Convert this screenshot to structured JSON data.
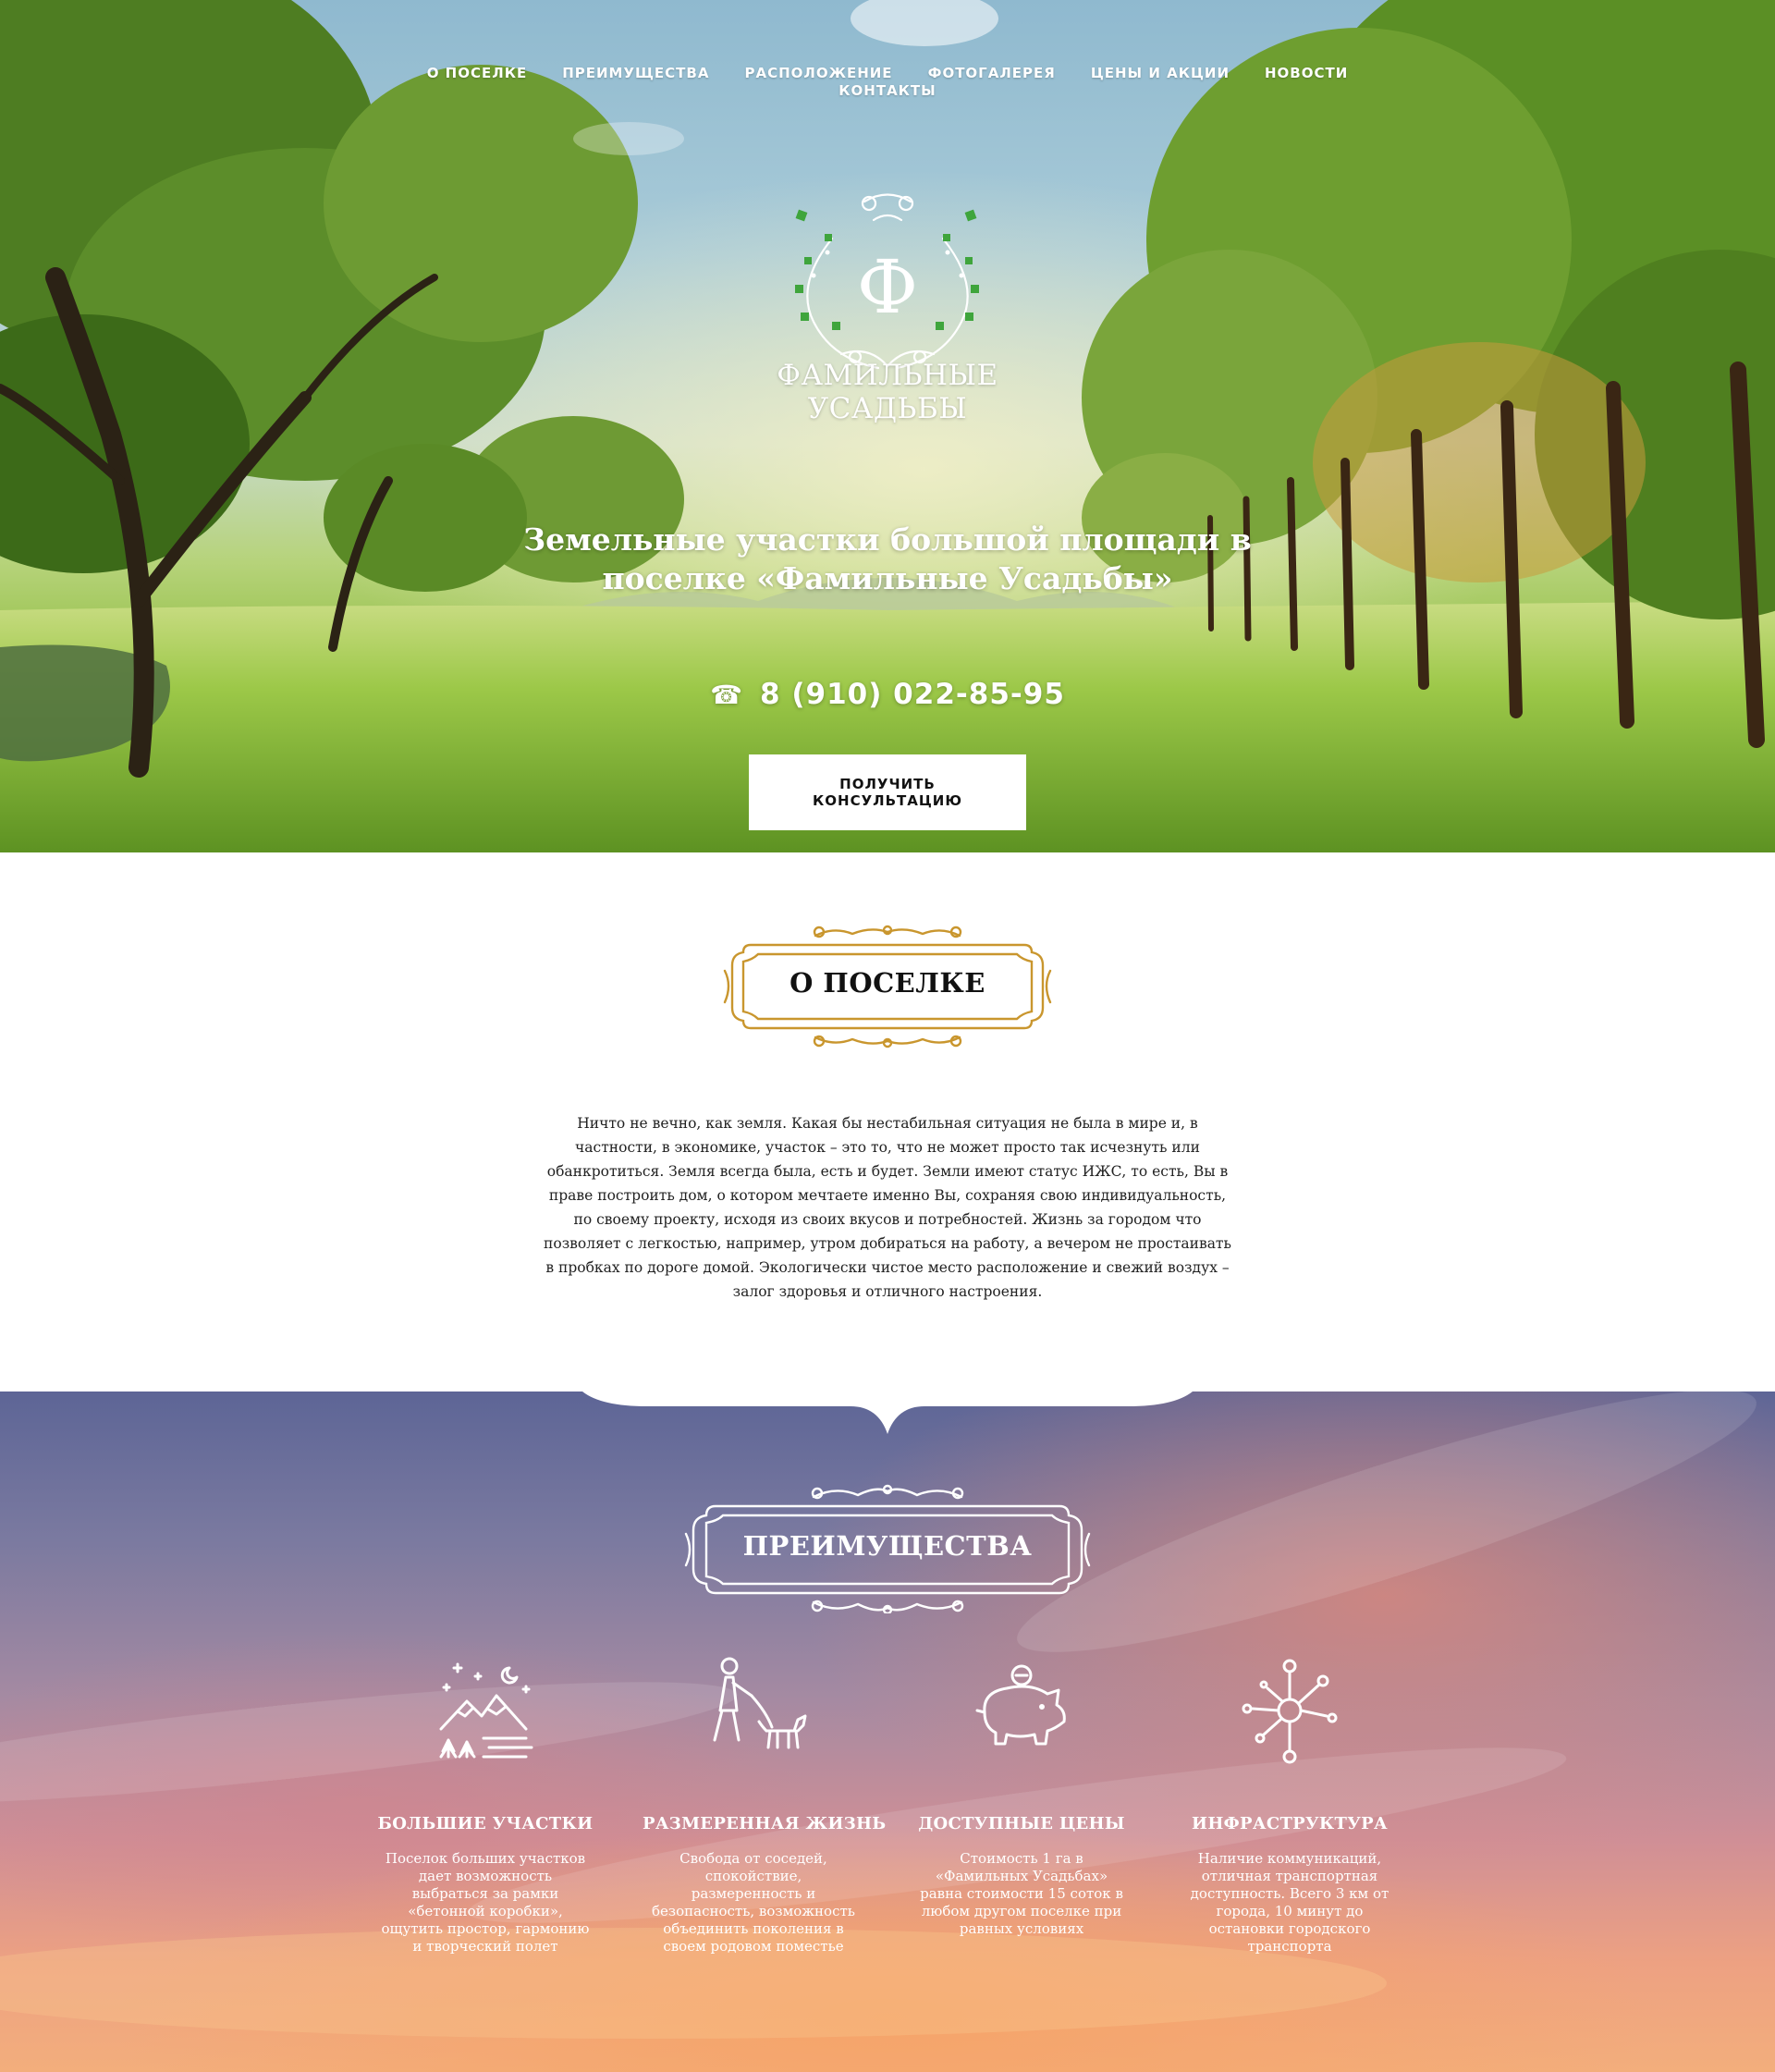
{
  "nav": {
    "items": [
      {
        "label": "О поселке"
      },
      {
        "label": "Преимущества"
      },
      {
        "label": "Расположение"
      },
      {
        "label": "Фотогалерея"
      },
      {
        "label": "Цены и акции"
      },
      {
        "label": "Новости"
      },
      {
        "label": "Контакты"
      }
    ]
  },
  "hero": {
    "logo_letter": "Ф",
    "logo_name_line1": "Фамильные",
    "logo_name_line2": "Усадьбы",
    "title": "Земельные участки большой площади в поселке «Фамильные Усадьбы»",
    "phone_icon": "☎",
    "phone": "8 (910) 022-85-95",
    "cta_label": "Получить консультацию"
  },
  "about": {
    "title": "О поселке",
    "text": "Ничто не вечно, как земля. Какая бы нестабильная ситуация не была в мире и, в частности, в экономике, участок – это то, что не может просто так исчезнуть или обанкротиться. Земля всегда была, есть и будет. Земли имеют статус ИЖС, то есть, Вы в праве построить дом, о котором мечтаете именно Вы, сохраняя свою индивидуальность, по своему проекту, исходя из своих вкусов и потребностей. Жизнь за городом что позволяет с легкостью, например, утром добираться на работу, а вечером не простаивать в пробках по дороге домой. Экологически чистое место расположение и свежий воздух – залог здоровья и отличного настроения."
  },
  "advantages": {
    "title": "Преимущества",
    "items": [
      {
        "icon": "mountains-camp-icon",
        "title": "Большие участки",
        "text": "Поселок больших участков дает возможность выбраться за рамки «бетонной коробки», ощутить простор, гармонию и творческий полет"
      },
      {
        "icon": "walking-dog-icon",
        "title": "Размеренная жизнь",
        "text": "Свобода от соседей, спокойствие, размеренность и безопасность, возможность объединить поколения в своем родовом поместье"
      },
      {
        "icon": "piggy-bank-icon",
        "title": "Доступные цены",
        "text": "Стоимость 1 га в «Фамильных Усадьбах» равна стоимости 15 соток в любом другом поселке при равных условиях"
      },
      {
        "icon": "network-icon",
        "title": "Инфраструктура",
        "text": "Наличие коммуникаций, отличная транспортная доступность. Всего 3 км от города, 10 минут до остановки городского транспорта"
      }
    ]
  },
  "colors": {
    "gold_frame": "#c9962e",
    "white": "#ffffff"
  }
}
